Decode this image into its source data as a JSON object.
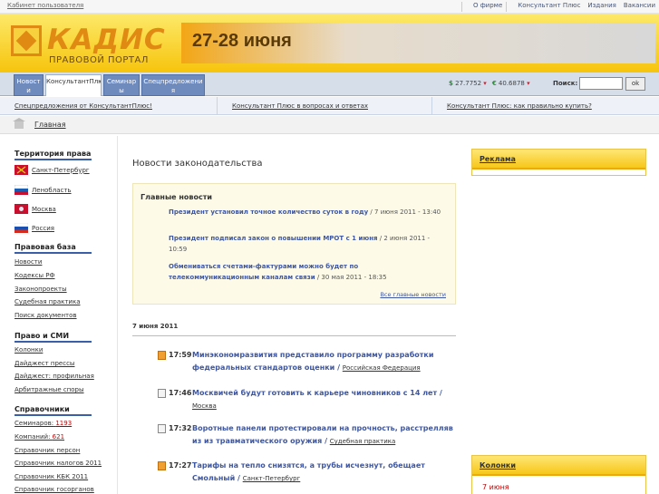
{
  "topbar": {
    "cabinet": "Кабинет пользователя",
    "links": [
      "О фирме",
      "Консультант Плюс",
      "Издания",
      "Вакансии"
    ]
  },
  "header": {
    "logo_name": "КАДИС",
    "logo_sub": "ПРАВОВОЙ ПОРТАЛ",
    "banner_text": "27-28 июня"
  },
  "nav": {
    "tabs": [
      "Новост и",
      "КонсультантПлюс",
      "Семинар ы",
      "Спецпредложени я"
    ],
    "rate_usd": "27.7752",
    "rate_eur": "40.6878",
    "search_label": "Поиск:",
    "search_value": "",
    "ok_label": "ok"
  },
  "promo": [
    "Спецпредложения от КонсультантПлюс!",
    "Консультант Плюс в вопросах и ответах",
    "Консультант Плюс: как правильно купить?"
  ],
  "breadcrumb": "Главная",
  "left": {
    "territory_title": "Территория права",
    "regions": [
      "Санкт-Петербург",
      "Ленобласть",
      "Москва",
      "Россия"
    ],
    "base_title": "Правовая база",
    "base_items": [
      "Новости",
      "Кодексы РФ",
      "Законопроекты",
      "Судебная практика",
      "Поиск документов"
    ],
    "smi_title": "Право и СМИ",
    "smi_items": [
      "Колонки",
      "Дайджест прессы",
      "Дайджест: профильная",
      "Арбитражные споры"
    ],
    "ref_title": "Справочники",
    "ref_items": [
      {
        "label": "Семинаров:",
        "count": "1193"
      },
      {
        "label": "Компаний:",
        "count": "621"
      },
      {
        "label": "Справочник персон",
        "count": ""
      },
      {
        "label": "Справочник налогов 2011",
        "count": ""
      },
      {
        "label": "Справочник КБК 2011",
        "count": ""
      },
      {
        "label": "Справочник госорганов",
        "count": ""
      }
    ]
  },
  "center": {
    "title": "Новости законодательства",
    "main_title": "Главные новости",
    "main_news": [
      {
        "text": "Президент установил точное количество суток в году",
        "date": " / 7 июня 2011 - 13:40"
      },
      {
        "text": "Президент подписал закон о повышении МРОТ с 1 июня",
        "date": " / 2 июня 2011 - 10:59"
      },
      {
        "text": "Обмениваться счетами-фактурами можно будет по телекоммуникационным каналам связи",
        "date": " / 30 мая 2011 - 18:35"
      }
    ],
    "all_news": "Все главные новости",
    "date": "7 июня 2011",
    "news": [
      {
        "time": "17:59",
        "text": "Минэкономразвития представило программу разработки федеральных стандартов оценки",
        "tag": "Российская Федерация"
      },
      {
        "time": "17:46",
        "text": "Москвичей будут готовить к карьере чиновников с 14 лет",
        "tag": "Москва"
      },
      {
        "time": "17:32",
        "text": "Воротные панели протестировали на прочность, расстрелляв из из травматического оружия",
        "tag": "Судебная практика"
      },
      {
        "time": "17:27",
        "text": "Тарифы на тепло снизятся, а трубы исчезнут, обещает Смольный",
        "tag": "Санкт-Петербург"
      }
    ]
  },
  "right": {
    "ads_title": "Реклама",
    "columns_title": "Колонки",
    "columns_date": "7 июня"
  }
}
